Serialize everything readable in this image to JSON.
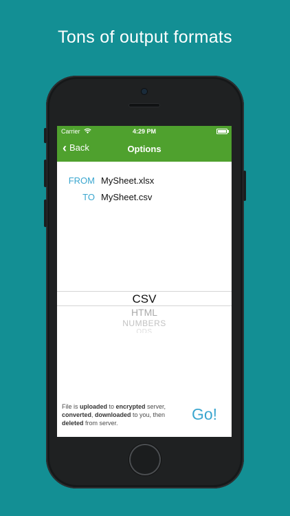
{
  "headline": "Tons of output formats",
  "status_bar": {
    "carrier": "Carrier",
    "wifi_icon": "wifi-icon",
    "time": "4:29 PM",
    "battery_icon": "battery-icon"
  },
  "nav": {
    "back_label": "Back",
    "title": "Options"
  },
  "conversion": {
    "from_label": "FROM",
    "from_value": "MySheet.xlsx",
    "to_label": "TO",
    "to_value": "MySheet.csv"
  },
  "picker": {
    "options": [
      "CSV",
      "HTML",
      "NUMBERS",
      "ODS"
    ],
    "selected": "CSV"
  },
  "footer": {
    "t1": "File is ",
    "b1": "uploaded",
    "t2": " to ",
    "b2": "encrypted",
    "t3": " server,",
    "b3": "converted",
    "t4": ", ",
    "b4": "downloaded",
    "t5": " to you, then",
    "b5": "deleted",
    "t6": " from server.",
    "go_label": "Go!"
  }
}
